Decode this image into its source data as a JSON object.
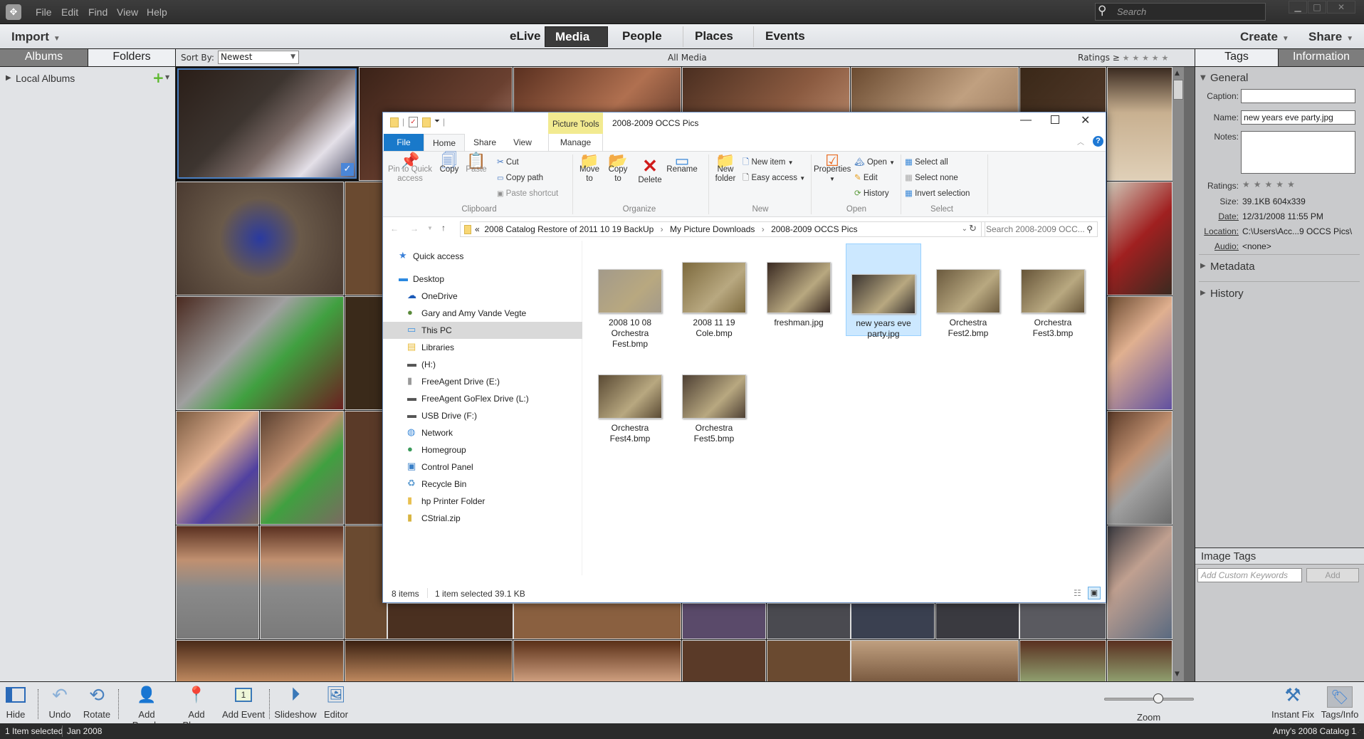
{
  "menubar": {
    "items": [
      "File",
      "Edit",
      "Find",
      "View",
      "Help"
    ],
    "search_placeholder": "Search",
    "window_controls": [
      "minimize",
      "maximize",
      "close"
    ]
  },
  "navbar": {
    "import_label": "Import",
    "tabs": [
      {
        "label": "eLive",
        "active": false
      },
      {
        "label": "Media",
        "active": true
      },
      {
        "label": "People",
        "active": false
      },
      {
        "label": "Places",
        "active": false
      },
      {
        "label": "Events",
        "active": false
      }
    ],
    "create_label": "Create",
    "share_label": "Share"
  },
  "subbar": {
    "albums_tab": "Albums",
    "folders_tab": "Folders",
    "sort_by_label": "Sort By:",
    "sort_by_value": "Newest",
    "view_title": "All Media",
    "ratings_label": "Ratings",
    "ratings_op": "≥",
    "tags_tab": "Tags",
    "information_tab": "Information"
  },
  "left_panel": {
    "local_albums_label": "Local Albums"
  },
  "right_panel": {
    "general_label": "General",
    "caption_label": "Caption:",
    "caption_value": "",
    "name_label": "Name:",
    "name_value": "new years eve party.jpg",
    "notes_label": "Notes:",
    "notes_value": "",
    "ratings_label": "Ratings:",
    "rating_value": 0,
    "rating_max": 5,
    "size_label": "Size:",
    "size_value": "39.1KB  604x339",
    "date_label": "Date:",
    "date_value": "12/31/2008 11:55 PM",
    "location_label": "Location:",
    "location_value": "C:\\Users\\Acc...9 OCCS Pics\\",
    "audio_label": "Audio:",
    "audio_value": "<none>",
    "metadata_label": "Metadata",
    "history_label": "History",
    "image_tags_label": "Image Tags",
    "keywords_placeholder": "Add Custom Keywords",
    "add_label": "Add"
  },
  "toolbar": {
    "hide": "Hide",
    "undo": "Undo",
    "rotate": "Rotate",
    "add_people": "Add People",
    "add_places": "Add Places",
    "add_event": "Add Event",
    "slideshow": "Slideshow",
    "editor": "Editor",
    "zoom": "Zoom",
    "zoom_level": 0.6,
    "instant_fix": "Instant Fix",
    "tags_info": "Tags/Info"
  },
  "statusbar": {
    "selection": "1 Item selected",
    "date": "Jan 2008",
    "catalog": "Amy's 2008 Catalog 1"
  },
  "explorer": {
    "title": "2008-2009 OCCS Pics",
    "contextual_tab": "Picture Tools",
    "tabs": [
      "File",
      "Home",
      "Share",
      "View",
      "Manage"
    ],
    "ribbon": {
      "clipboard": {
        "group": "Clipboard",
        "pin": "Pin to Quick access",
        "copy": "Copy",
        "paste": "Paste",
        "cut": "Cut",
        "copy_path": "Copy path",
        "paste_shortcut": "Paste shortcut"
      },
      "organize": {
        "group": "Organize",
        "move_to": "Move to",
        "copy_to": "Copy to",
        "delete": "Delete",
        "rename": "Rename"
      },
      "new": {
        "group": "New",
        "new_folder": "New folder",
        "new_item": "New item",
        "easy_access": "Easy access"
      },
      "open": {
        "group": "Open",
        "properties": "Properties",
        "open": "Open",
        "edit": "Edit",
        "history": "History"
      },
      "select": {
        "group": "Select",
        "select_all": "Select all",
        "select_none": "Select none",
        "invert_selection": "Invert selection"
      }
    },
    "address": {
      "overflow": "«",
      "crumbs": [
        "2008 Catalog Restore of 2011 10 19 BackUp",
        "My Picture Downloads",
        "2008-2009 OCCS Pics"
      ],
      "search_placeholder": "Search 2008-2009 OCC..."
    },
    "nav_items": [
      {
        "label": "Quick access",
        "icon": "star"
      },
      {
        "label": "Desktop",
        "icon": "desktop"
      },
      {
        "label": "OneDrive",
        "icon": "cloud"
      },
      {
        "label": "Gary and Amy Vande Vegte",
        "icon": "user"
      },
      {
        "label": "This PC",
        "icon": "computer",
        "selected": true
      },
      {
        "label": "Libraries",
        "icon": "library"
      },
      {
        "label": " (H:)",
        "icon": "drive"
      },
      {
        "label": "FreeAgent Drive (E:)",
        "icon": "external-drive"
      },
      {
        "label": "FreeAgent GoFlex Drive (L:)",
        "icon": "drive"
      },
      {
        "label": "USB Drive (F:)",
        "icon": "drive"
      },
      {
        "label": "Network",
        "icon": "network"
      },
      {
        "label": "Homegroup",
        "icon": "homegroup"
      },
      {
        "label": "Control Panel",
        "icon": "control-panel"
      },
      {
        "label": "Recycle Bin",
        "icon": "recycle-bin"
      },
      {
        "label": "hp Printer Folder",
        "icon": "folder"
      },
      {
        "label": "CStrial.zip",
        "icon": "zip"
      }
    ],
    "files": [
      {
        "name": "2008 10 08 Orchestra Fest.bmp",
        "selected": false,
        "color": "#a39a8a"
      },
      {
        "name": "2008 11 19 Cole.bmp",
        "selected": false,
        "color": "#7d6a3e"
      },
      {
        "name": "freshman.jpg",
        "selected": false,
        "color": "#3a2a22"
      },
      {
        "name": "new years eve party.jpg",
        "selected": true,
        "color": "#3b3430"
      },
      {
        "name": "Orchestra Fest2.bmp",
        "selected": false,
        "color": "#6b5a3e"
      },
      {
        "name": "Orchestra Fest3.bmp",
        "selected": false,
        "color": "#665438"
      },
      {
        "name": "Orchestra Fest4.bmp",
        "selected": false,
        "color": "#5a4a34"
      },
      {
        "name": "Orchestra Fest5.bmp",
        "selected": false,
        "color": "#4e4034"
      }
    ],
    "status": {
      "count": "8 items",
      "selection": "1 item selected  39.1 KB"
    }
  }
}
